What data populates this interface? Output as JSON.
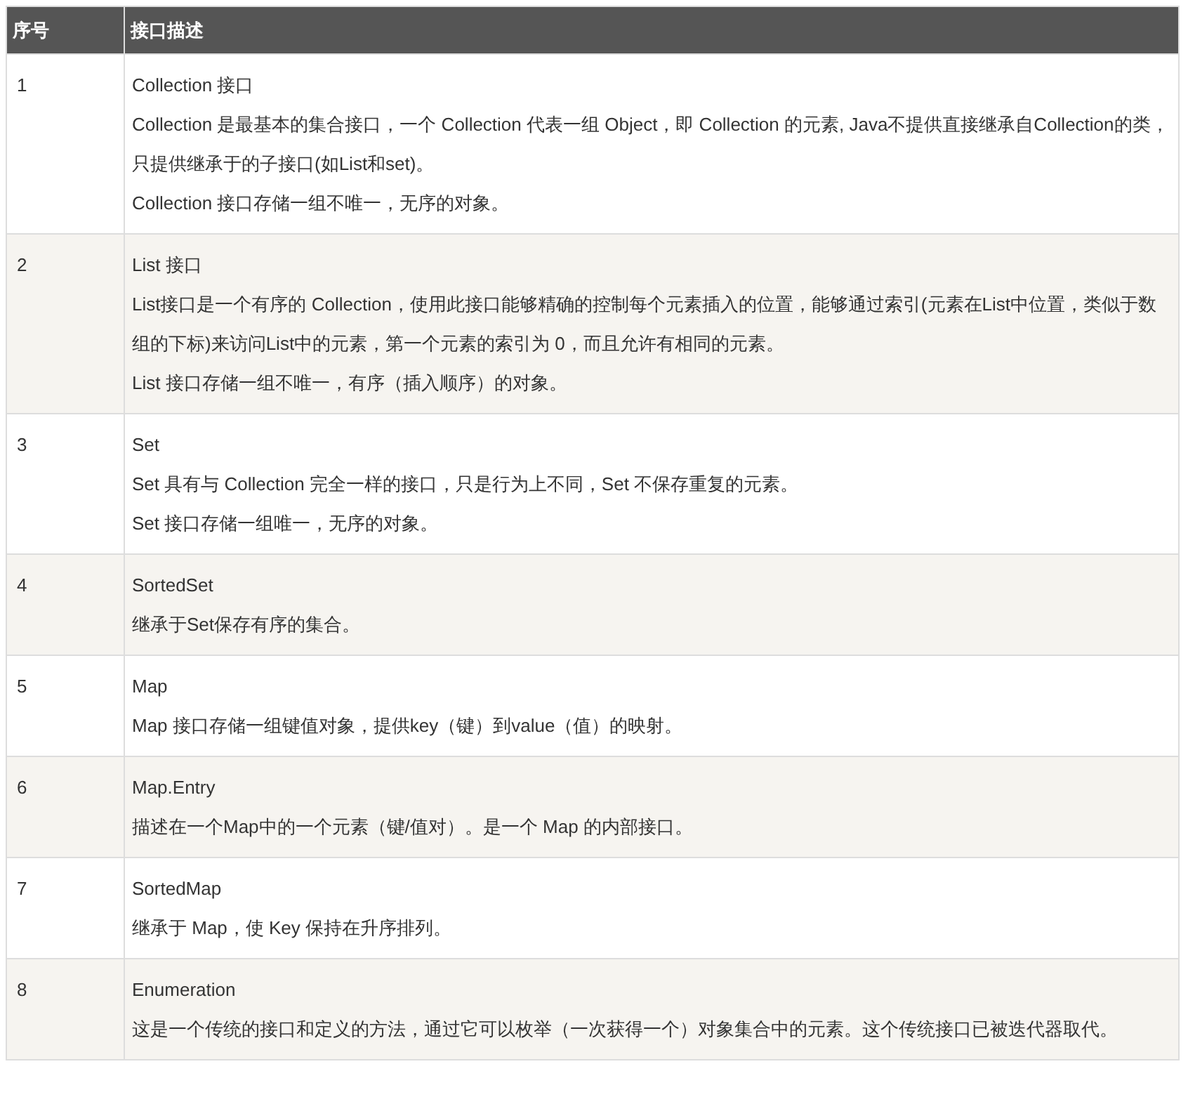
{
  "table": {
    "columns": [
      "序号",
      "接口描述"
    ],
    "rows": [
      {
        "number": "1",
        "lines": [
          "Collection 接口",
          "Collection 是最基本的集合接口，一个 Collection 代表一组 Object，即 Collection 的元素, Java不提供直接继承自Collection的类，只提供继承于的子接口(如List和set)。",
          "Collection 接口存储一组不唯一，无序的对象。"
        ]
      },
      {
        "number": "2",
        "lines": [
          "List 接口",
          "List接口是一个有序的 Collection，使用此接口能够精确的控制每个元素插入的位置，能够通过索引(元素在List中位置，类似于数组的下标)来访问List中的元素，第一个元素的索引为 0，而且允许有相同的元素。",
          "List 接口存储一组不唯一，有序（插入顺序）的对象。"
        ]
      },
      {
        "number": "3",
        "lines": [
          "Set",
          "Set 具有与 Collection 完全一样的接口，只是行为上不同，Set 不保存重复的元素。",
          "Set 接口存储一组唯一，无序的对象。"
        ]
      },
      {
        "number": "4",
        "lines": [
          "SortedSet",
          "继承于Set保存有序的集合。"
        ]
      },
      {
        "number": "5",
        "lines": [
          "Map",
          "Map 接口存储一组键值对象，提供key（键）到value（值）的映射。"
        ]
      },
      {
        "number": "6",
        "lines": [
          "Map.Entry",
          "描述在一个Map中的一个元素（键/值对）。是一个 Map 的内部接口。"
        ]
      },
      {
        "number": "7",
        "lines": [
          "SortedMap",
          "继承于 Map，使 Key 保持在升序排列。"
        ]
      },
      {
        "number": "8",
        "lines": [
          "Enumeration",
          "这是一个传统的接口和定义的方法，通过它可以枚举（一次获得一个）对象集合中的元素。这个传统接口已被迭代器取代。"
        ]
      }
    ]
  }
}
